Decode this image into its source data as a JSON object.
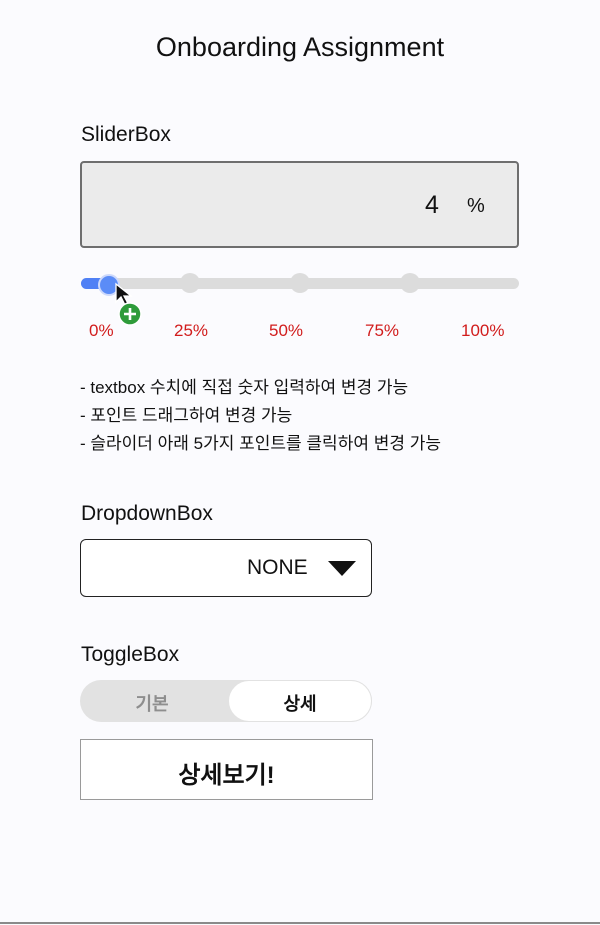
{
  "page": {
    "title": "Onboarding Assignment"
  },
  "slider_box": {
    "label": "SliderBox",
    "input_value": "4",
    "unit": "%",
    "value_percent": 4,
    "points": [
      "0%",
      "25%",
      "50%",
      "75%",
      "100%"
    ],
    "description": [
      "- textbox 수치에 직접 숫자 입력하여 변경 가능",
      "- 포인트 드래그하여 변경 가능",
      "- 슬라이더 아래 5가지 포인트를 클릭하여 변경 가능"
    ],
    "accent_color": "#4f80f5",
    "point_label_color": "#d11c1c"
  },
  "dropdown_box": {
    "label": "DropdownBox",
    "selected": "NONE",
    "icon": "caret-down-icon"
  },
  "toggle_box": {
    "label": "ToggleBox",
    "options": [
      "기본",
      "상세"
    ],
    "selected": "상세",
    "detail_text": "상세보기!"
  }
}
